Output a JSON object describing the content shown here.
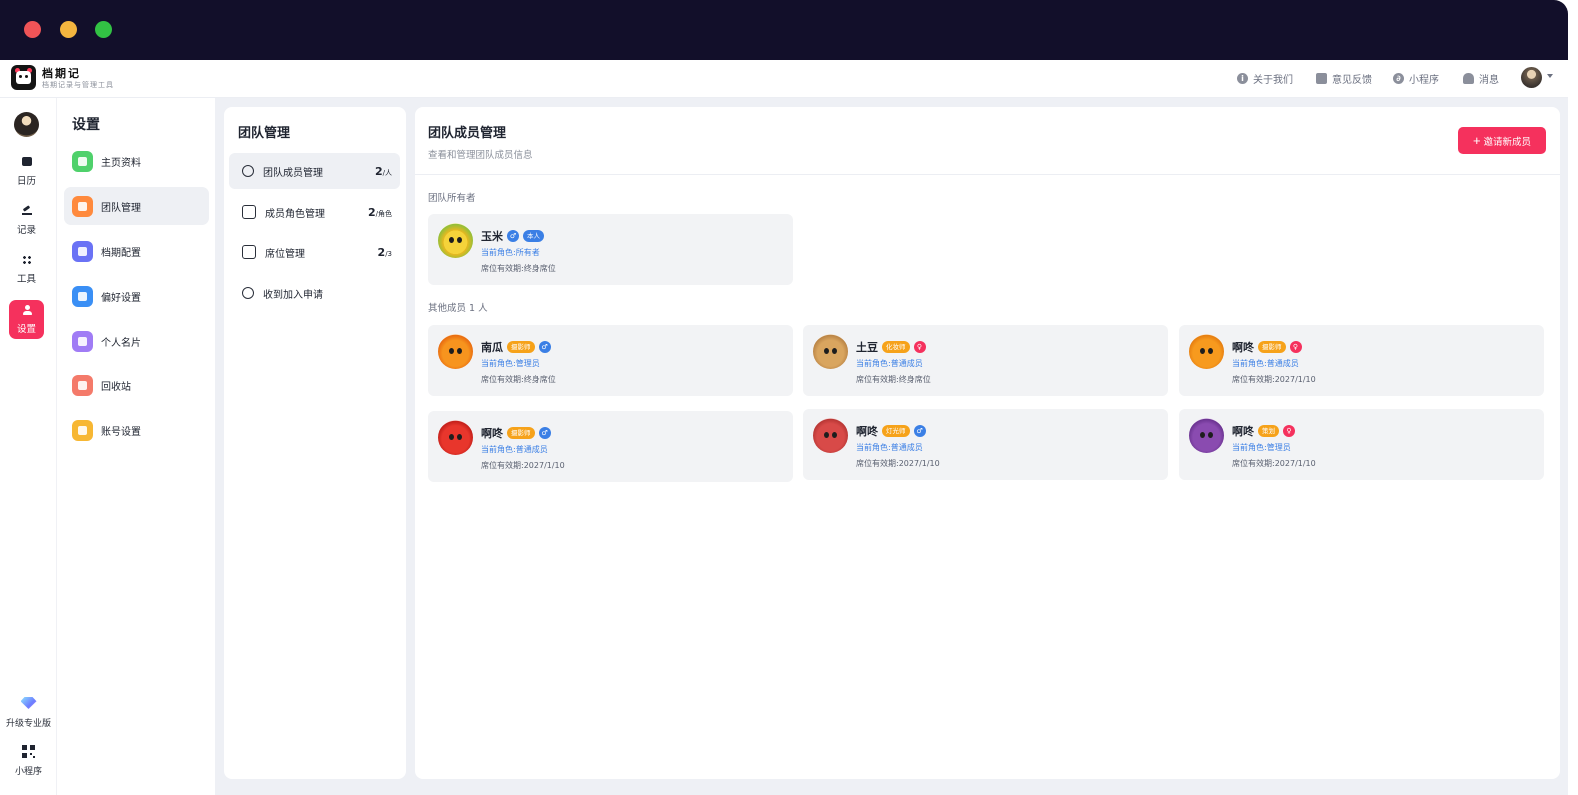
{
  "app": {
    "name": "档期记",
    "subtitle": "档期记录与管理工具"
  },
  "top_nav": [
    {
      "label": "关于我们",
      "icon": "info-icon"
    },
    {
      "label": "意见反馈",
      "icon": "feedback-icon"
    },
    {
      "label": "小程序",
      "icon": "mini-program-icon"
    },
    {
      "label": "消息",
      "icon": "bell-icon"
    }
  ],
  "rail": {
    "items": [
      {
        "label": "日历",
        "icon": "calendar-icon"
      },
      {
        "label": "记录",
        "icon": "edit-icon"
      },
      {
        "label": "工具",
        "icon": "grid-icon"
      },
      {
        "label": "设置",
        "icon": "user-icon"
      }
    ],
    "upgrade_label": "升级专业版",
    "mini_program_label": "小程序"
  },
  "settings": {
    "title": "设置",
    "items": [
      {
        "label": "主页资料",
        "color": "#4fd16b"
      },
      {
        "label": "团队管理",
        "color": "#ff8a3d"
      },
      {
        "label": "档期配置",
        "color": "#6a72f5"
      },
      {
        "label": "偏好设置",
        "color": "#3a8ff5"
      },
      {
        "label": "个人名片",
        "color": "#a07cf5"
      },
      {
        "label": "回收站",
        "color": "#f47a6a"
      },
      {
        "label": "账号设置",
        "color": "#f7b733"
      }
    ]
  },
  "team": {
    "title": "团队管理",
    "items": [
      {
        "label": "团队成员管理",
        "count": "2",
        "unit": "/人"
      },
      {
        "label": "成员角色管理",
        "count": "2",
        "unit": "/角色"
      },
      {
        "label": "席位管理",
        "count": "2",
        "unit": "/3"
      },
      {
        "label": "收到加入申请",
        "count": "",
        "unit": ""
      }
    ]
  },
  "main": {
    "title": "团队成员管理",
    "subtitle": "查看和管理团队成员信息",
    "invite_label": "邀请新成员",
    "owner_section": "团队所有者",
    "others_section": "其他成员 1 人"
  },
  "owner": {
    "name": "玉米",
    "gender": "♂",
    "tag": "本人",
    "role_label": "当前角色:",
    "role": "所有者",
    "valid_label": "席位有效期:",
    "valid": "终身席位"
  },
  "members": [
    {
      "name": "南瓜",
      "tag": "摄影师",
      "gender": "♂",
      "role_label": "当前角色:",
      "role": "管理员",
      "valid_label": "席位有效期:",
      "valid": "终身席位"
    },
    {
      "name": "土豆",
      "tag": "化妆师",
      "gender": "♀",
      "role_label": "当前角色:",
      "role": "普通成员",
      "valid_label": "席位有效期:",
      "valid": "终身席位"
    },
    {
      "name": "啊咚",
      "tag": "摄影师",
      "gender": "♀",
      "role_label": "当前角色:",
      "role": "普通成员",
      "valid_label": "席位有效期:",
      "valid": "2027/1/10"
    },
    {
      "name": "啊咚",
      "tag": "摄影师",
      "gender": "♂",
      "role_label": "当前角色:",
      "role": "普通成员",
      "valid_label": "席位有效期:",
      "valid": "2027/1/10"
    },
    {
      "name": "啊咚",
      "tag": "灯光师",
      "gender": "♂",
      "role_label": "当前角色:",
      "role": "普通成员",
      "valid_label": "席位有效期:",
      "valid": "2027/1/10"
    },
    {
      "name": "啊咚",
      "tag": "策划",
      "gender": "♀",
      "role_label": "当前角色:",
      "role": "管理员",
      "valid_label": "席位有效期:",
      "valid": "2027/1/10"
    }
  ],
  "colors": {
    "accent": "#f5315d",
    "titlebar": "#120f2a",
    "link": "#3b7fe5",
    "tag": "#f6a21a"
  }
}
